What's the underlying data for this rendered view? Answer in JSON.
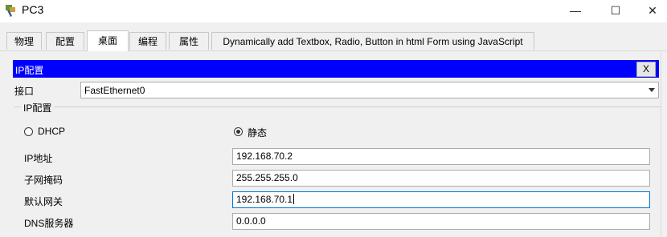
{
  "window": {
    "title": "PC3",
    "minimize_glyph": "—",
    "maximize_glyph": "☐",
    "close_glyph": "✕"
  },
  "tabs": [
    {
      "label": "物理"
    },
    {
      "label": "配置"
    },
    {
      "label": "桌面"
    },
    {
      "label": "编程"
    },
    {
      "label": "属性"
    },
    {
      "label": "Dynamically add Textbox, Radio, Button in html Form using JavaScript"
    }
  ],
  "active_tab": "桌面",
  "ip_config": {
    "title": "IP配置",
    "close_label": "X",
    "interface_label": "接口",
    "interface_value": "FastEthernet0",
    "group_title": "IP配置",
    "dhcp_label": "DHCP",
    "static_label": "静态",
    "selected_mode": "静态",
    "ip_label": "IP地址",
    "ip_value": "192.168.70.2",
    "mask_label": "子网掩码",
    "mask_value": "255.255.255.0",
    "gateway_label": "默认网关",
    "gateway_value": "192.168.70.1",
    "dns_label": "DNS服务器",
    "dns_value": "0.0.0.0"
  },
  "colors": {
    "title_bar_blue": "#0000ff",
    "focus_border": "#0078d7"
  }
}
